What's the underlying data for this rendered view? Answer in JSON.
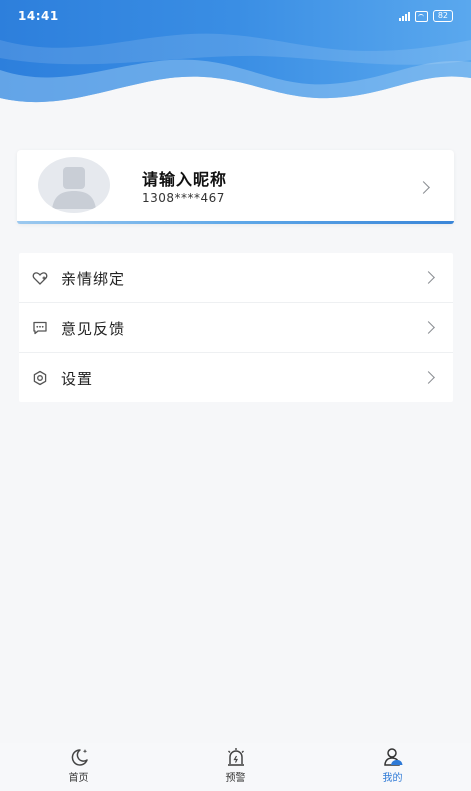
{
  "status_bar": {
    "time": "14:41",
    "battery": "82"
  },
  "profile": {
    "nickname": "请输入昵称",
    "phone": "1308****467"
  },
  "menu": {
    "items": [
      {
        "label": "亲情绑定",
        "icon": "heart-link-icon"
      },
      {
        "label": "意见反馈",
        "icon": "chat-bubble-icon"
      },
      {
        "label": "设置",
        "icon": "settings-hexagon-icon"
      }
    ]
  },
  "tabbar": {
    "tabs": [
      {
        "label": "首页",
        "icon": "moon-stars-icon",
        "active": false
      },
      {
        "label": "预警",
        "icon": "alarm-light-icon",
        "active": false
      },
      {
        "label": "我的",
        "icon": "user-icon",
        "active": true
      }
    ]
  },
  "colors": {
    "header_blue": "#2f83de",
    "accent": "#2f7ad6",
    "background": "#f6f7f9"
  }
}
